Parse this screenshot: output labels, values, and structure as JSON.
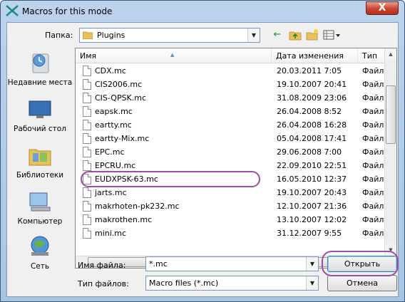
{
  "window": {
    "title": "Macros for this mode",
    "close_label": "X"
  },
  "lookin": {
    "label": "Папка:",
    "value": "Plugins"
  },
  "toolbar": {
    "back": "←",
    "up": "↑",
    "new_folder": "✱",
    "view": "▦"
  },
  "places": [
    {
      "label": "Недавние места",
      "icon": "recent-places-icon"
    },
    {
      "label": "Рабочий стол",
      "icon": "desktop-icon"
    },
    {
      "label": "Библиотеки",
      "icon": "libraries-icon"
    },
    {
      "label": "Компьютер",
      "icon": "computer-icon"
    },
    {
      "label": "Сеть",
      "icon": "network-icon"
    }
  ],
  "columns": {
    "name": "Имя",
    "date": "Дата изменения",
    "type": "Тип"
  },
  "files": [
    {
      "name": "CDX.mc",
      "date": "20.03.2011 7:05",
      "type": "Файл '"
    },
    {
      "name": "CIS2006.mc",
      "date": "19.10.2007 20:41",
      "type": "Файл '"
    },
    {
      "name": "CIS-QPSK.mc",
      "date": "31.08.2009 23:06",
      "type": "Файл '"
    },
    {
      "name": "eapsk.mc",
      "date": "26.04.2008 8:52",
      "type": "Файл '"
    },
    {
      "name": "eartty.mc",
      "date": "26.04.2008 16:28",
      "type": "Файл '"
    },
    {
      "name": "eartty-Mix.mc",
      "date": "05.04.2008 17:41",
      "type": "Файл '"
    },
    {
      "name": "EPC.mc",
      "date": "29.06.2008 7:00",
      "type": "Файл '"
    },
    {
      "name": "EPCRU.mc",
      "date": "22.09.2010 22:51",
      "type": "Файл '"
    },
    {
      "name": "EUDXPSK-63.mc",
      "date": "16.05.2010 12:37",
      "type": "Файл '"
    },
    {
      "name": "jarts.mc",
      "date": "19.10.2007 20:43",
      "type": "Файл '"
    },
    {
      "name": "makrhoten-pk232.mc",
      "date": "12.10.2007 21:36",
      "type": "Файл '"
    },
    {
      "name": "makrothen.mc",
      "date": "13.10.2007 12:02",
      "type": "Файл '"
    },
    {
      "name": "mini.mc",
      "date": "31.12.2007 9:55",
      "type": "Файл '"
    }
  ],
  "filename": {
    "label": "Имя файла:",
    "value": "*.mc"
  },
  "filetype": {
    "label": "Тип файлов:",
    "value": "Macro files (*.mc)"
  },
  "buttons": {
    "open": "Открыть",
    "cancel": "Отмена"
  },
  "colors": {
    "highlight_ring": "#9a4fa0",
    "title_gradient": "#bcd3ec",
    "close_red": "#c7442e"
  }
}
